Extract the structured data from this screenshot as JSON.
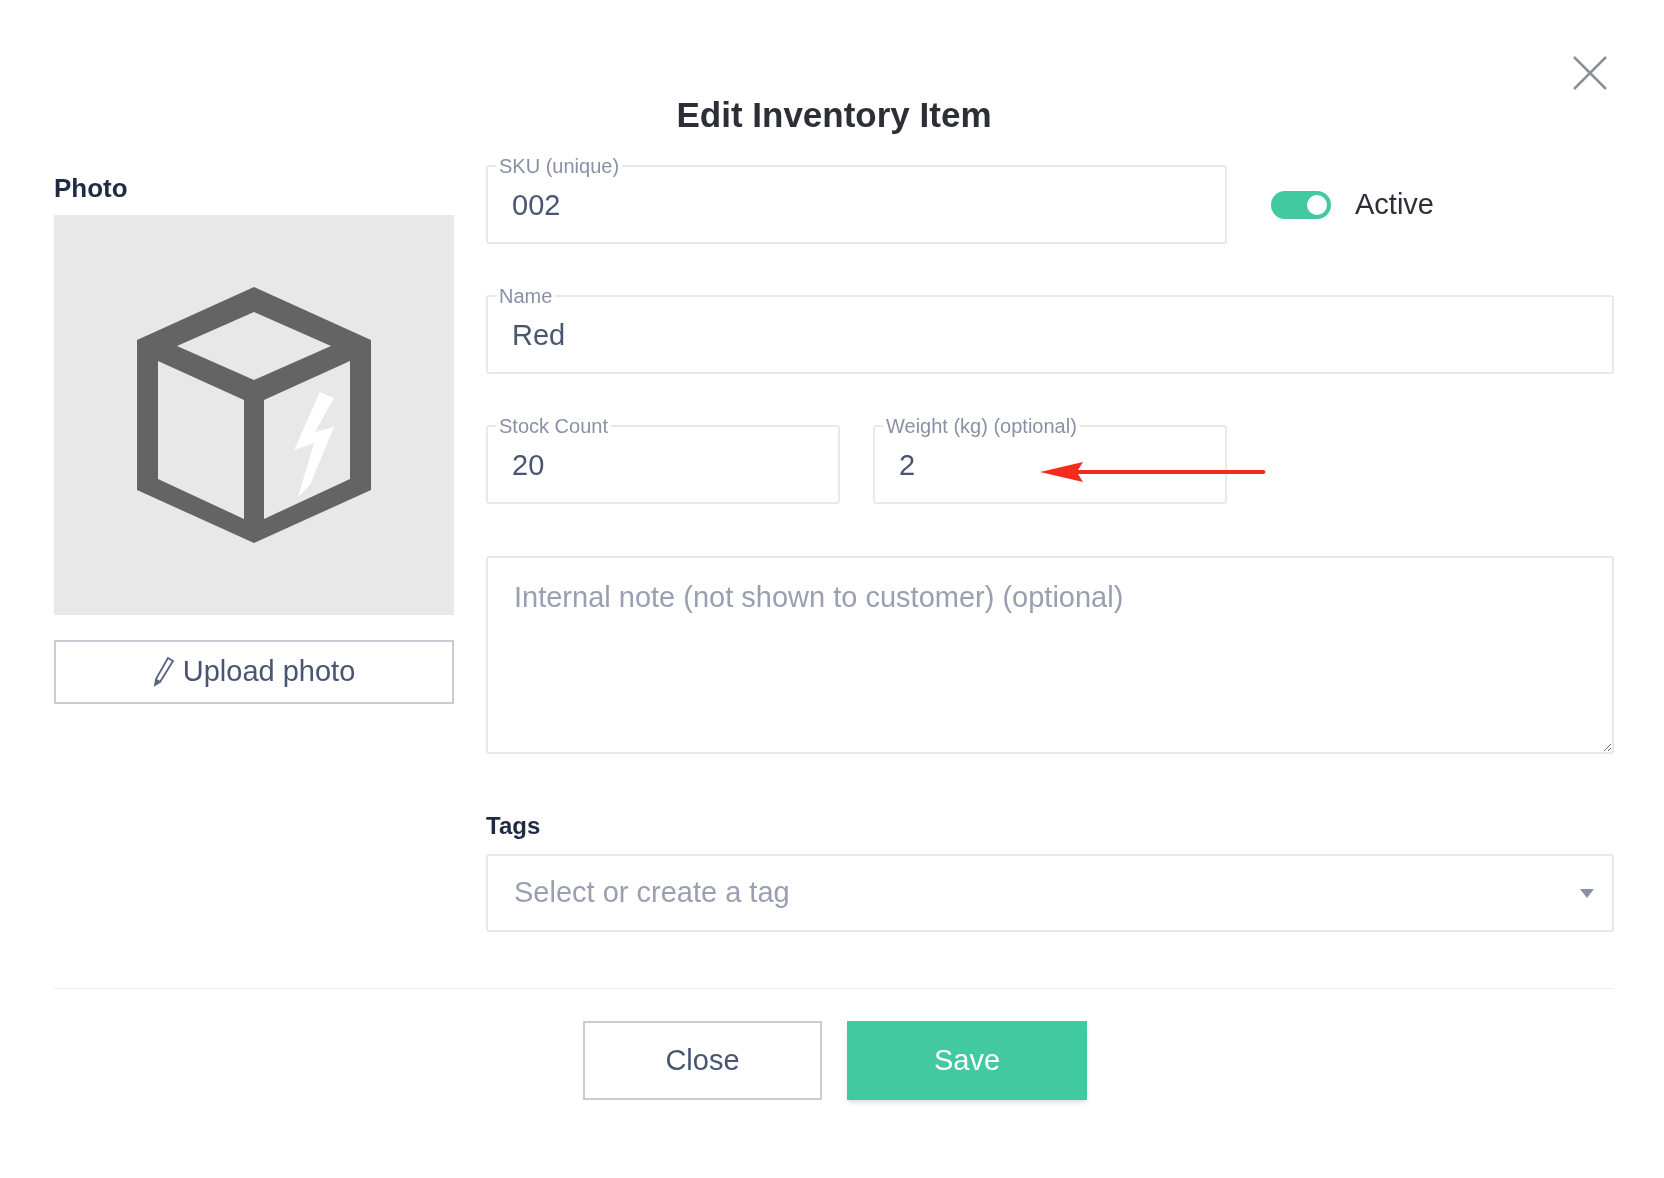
{
  "dialog": {
    "title": "Edit Inventory Item"
  },
  "photo": {
    "label": "Photo",
    "upload_button": "Upload photo"
  },
  "sku": {
    "label": "SKU (unique)",
    "value": "002"
  },
  "active_toggle": {
    "label": "Active",
    "on": true
  },
  "name": {
    "label": "Name",
    "value": "Red"
  },
  "stock_count": {
    "label": "Stock Count",
    "value": "20"
  },
  "weight": {
    "label": "Weight (kg) (optional)",
    "value": "2"
  },
  "note": {
    "placeholder": "Internal note (not shown to customer) (optional)"
  },
  "tags": {
    "label": "Tags",
    "placeholder": "Select or create a tag"
  },
  "buttons": [
    {
      "label": "Close",
      "kind": "secondary"
    },
    {
      "label": "Save",
      "kind": "primary"
    }
  ]
}
